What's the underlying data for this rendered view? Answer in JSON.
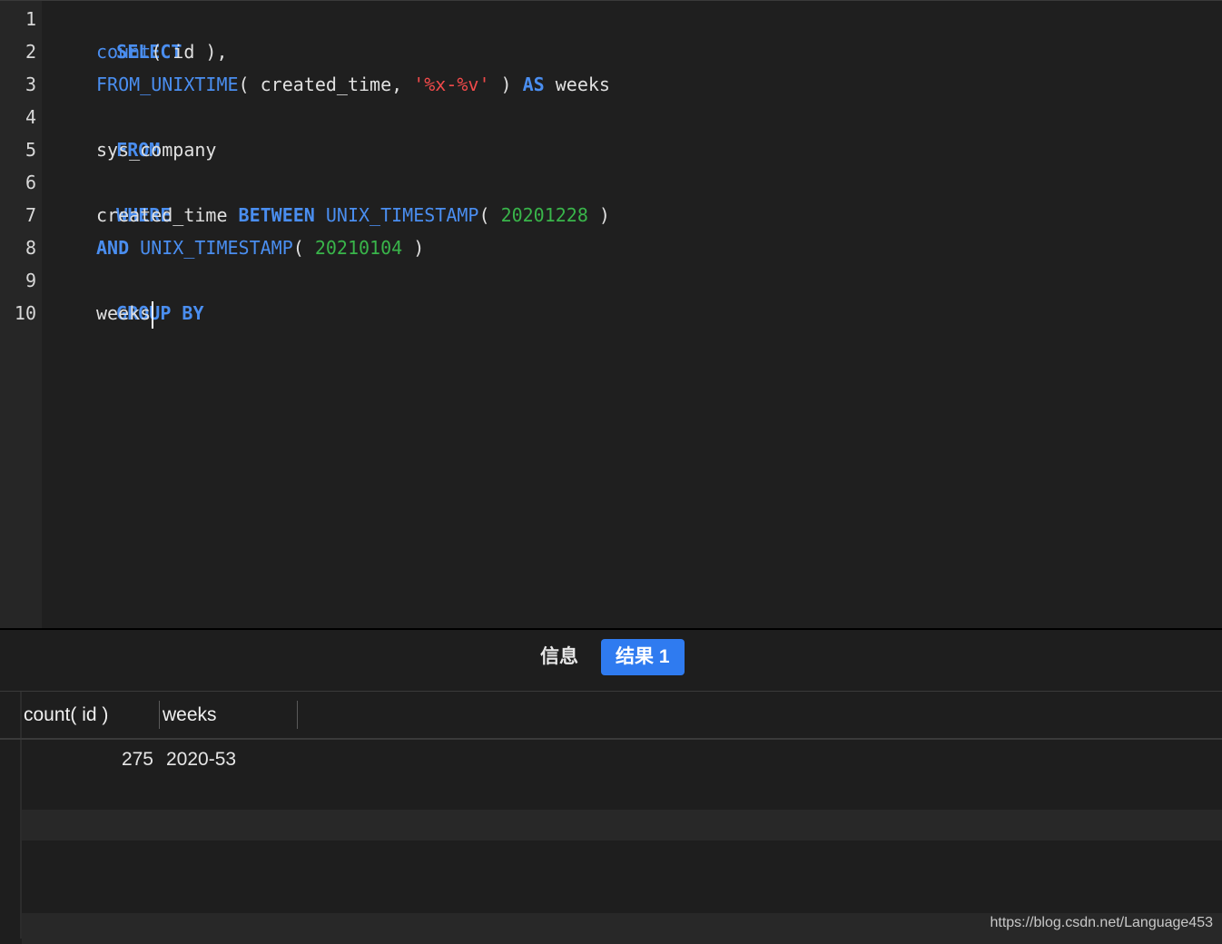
{
  "editor": {
    "line_numbers": [
      "1",
      "2",
      "3",
      "4",
      "5",
      "6",
      "7",
      "8",
      "9",
      "10"
    ],
    "lines": {
      "l1": {
        "kw": "SELECT"
      },
      "l2": {
        "fn": "count",
        "rest": "( id ),"
      },
      "l3": {
        "fn": "FROM_UNIXTIME",
        "mid": "( created_time, ",
        "str": "'%x-%v'",
        "mid2": " ) ",
        "kw": "AS",
        "rest": " weeks"
      },
      "l4": {
        "kw": "FROM"
      },
      "l5": {
        "rest": "sys_company"
      },
      "l6": {
        "kw": "WHERE"
      },
      "l7": {
        "pre": "created_time ",
        "kw": "BETWEEN",
        "sp": " ",
        "fn": "UNIX_TIMESTAMP",
        "mid": "( ",
        "num": "20201228",
        "rest": " )"
      },
      "l8": {
        "kw": "AND",
        "sp": " ",
        "fn": "UNIX_TIMESTAMP",
        "mid": "( ",
        "num": "20210104",
        "rest": " )"
      },
      "l9": {
        "kw": "GROUP BY"
      },
      "l10": {
        "rest": "weeks"
      }
    }
  },
  "result_tabs": {
    "info": "信息",
    "result1": "结果 1"
  },
  "grid": {
    "columns": [
      "count( id )",
      "weeks"
    ],
    "rows": [
      {
        "count": "275",
        "weeks": "2020-53"
      }
    ]
  },
  "watermark": "https://blog.csdn.net/Language453",
  "colors": {
    "keyword": "#4a8ef0",
    "string": "#f04a4a",
    "number": "#39b54a",
    "active_tab": "#2f7bf0"
  }
}
